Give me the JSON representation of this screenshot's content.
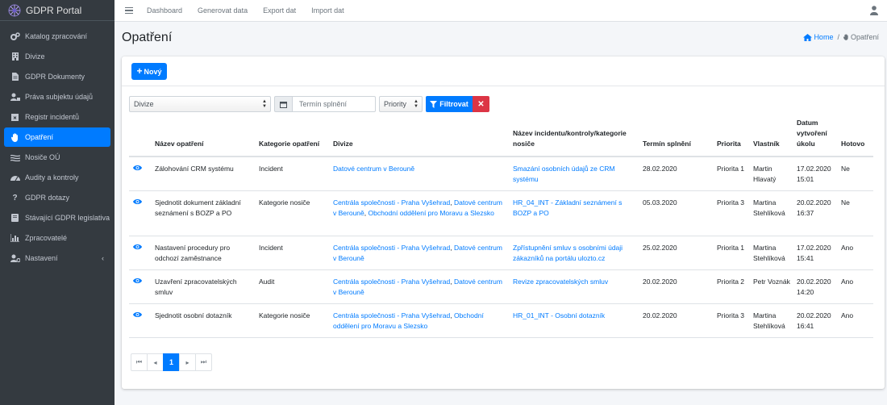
{
  "brand": {
    "name": "GDPR Portal"
  },
  "sidebar": {
    "items": [
      {
        "label": "Katalog zpracování",
        "icon": "cogs-icon"
      },
      {
        "label": "Divize",
        "icon": "building-icon"
      },
      {
        "label": "GDPR Dokumenty",
        "icon": "file-icon"
      },
      {
        "label": "Práva subjektu údajů",
        "icon": "user-lock-icon"
      },
      {
        "label": "Registr incidentů",
        "icon": "calendar-x-icon"
      },
      {
        "label": "Opatření",
        "icon": "hand-icon",
        "active": true
      },
      {
        "label": "Nosiče OÚ",
        "icon": "stream-icon"
      },
      {
        "label": "Audity a kontroly",
        "icon": "tachometer-icon"
      },
      {
        "label": "GDPR dotazy",
        "icon": "question-icon"
      },
      {
        "label": "Stávající GDPR legislativa",
        "icon": "book-icon"
      },
      {
        "label": "Zpracovatelé",
        "icon": "chart-icon"
      },
      {
        "label": "Nastavení",
        "icon": "user-cog-icon",
        "has_children": true
      }
    ]
  },
  "topnav": {
    "links": [
      "Dashboard",
      "Generovat data",
      "Export dat",
      "Import dat"
    ]
  },
  "page": {
    "title": "Opatření"
  },
  "breadcrumb": {
    "home": "Home",
    "current": "Opatření"
  },
  "toolbar": {
    "new_label": "Nový"
  },
  "filters": {
    "divize": "Divize",
    "termin_placeholder": "Termín splnění",
    "priorita": "Priority",
    "filter_label": "Filtrovat",
    "clear_label": "✕"
  },
  "table": {
    "headers": [
      "Název opatření",
      "Kategorie opatření",
      "Divize",
      "Název incidentu/kontroly/kategorie nosiče",
      "Termín splnění",
      "Priorita",
      "Vlastník",
      "Datum vytvoření úkolu",
      "Hotovo"
    ],
    "rows": [
      {
        "name": "Zálohování CRM systému",
        "kategorie": "Incident",
        "divize": [
          "Datové centrum v Berouně"
        ],
        "incident": "Smazání osobních údajů ze CRM systému",
        "termin": "28.02.2020",
        "priorita": "Priorita 1",
        "vlastnik": "Martin Hlavatý",
        "datum": "17.02.2020 15:01",
        "hotovo": "Ne"
      },
      {
        "name": "Sjednotit dokument základní seznámení s BOZP a PO",
        "kategorie": "Kategorie nosiče",
        "divize": [
          "Centrála společnosti - Praha Vyšehrad",
          "Datové centrum v Berouně",
          "Obchodní oddělení pro Moravu a Slezsko"
        ],
        "incident": "HR_04_INT - Základní seznámení s BOZP a PO",
        "termin": "05.03.2020",
        "priorita": "Priorita 3",
        "vlastnik": "Martina Stehlíková",
        "datum": "20.02.2020 16:37",
        "hotovo": "Ne"
      },
      {
        "name": "Nastavení procedury pro odchozí zaměstnance",
        "kategorie": "Incident",
        "divize": [
          "Centrála společnosti - Praha Vyšehrad",
          "Datové centrum v Berouně"
        ],
        "incident": "Zpřístupnění smluv s osobními údaji zákazníků na portálu ulozto.cz",
        "termin": "25.02.2020",
        "priorita": "Priorita 1",
        "vlastnik": "Martina Stehlíková",
        "datum": "17.02.2020 15:41",
        "hotovo": "Ano"
      },
      {
        "name": "Uzavření zpracovatelských smluv",
        "kategorie": "Audit",
        "divize": [
          "Centrála společnosti - Praha Vyšehrad",
          "Datové centrum v Berouně"
        ],
        "incident": "Revize zpracovatelských smluv",
        "termin": "20.02.2020",
        "priorita": "Priorita 2",
        "vlastnik": "Petr Voznák",
        "datum": "20.02.2020 14:20",
        "hotovo": "Ano"
      },
      {
        "name": "Sjednotit osobní dotazník",
        "kategorie": "Kategorie nosiče",
        "divize": [
          "Centrála společnosti - Praha Vyšehrad",
          "Obchodní oddělení pro Moravu a Slezsko"
        ],
        "incident": "HR_01_INT - Osobní dotazník",
        "termin": "20.02.2020",
        "priorita": "Priorita 3",
        "vlastnik": "Martina Stehlíková",
        "datum": "20.02.2020 16:41",
        "hotovo": "Ano"
      }
    ]
  },
  "pagination": {
    "first": "⏮",
    "prev": "◂",
    "current": "1",
    "next": "▸",
    "last": "⏭"
  },
  "colors": {
    "primary": "#007bff",
    "danger": "#dc3545",
    "sidebar": "#343a40"
  }
}
